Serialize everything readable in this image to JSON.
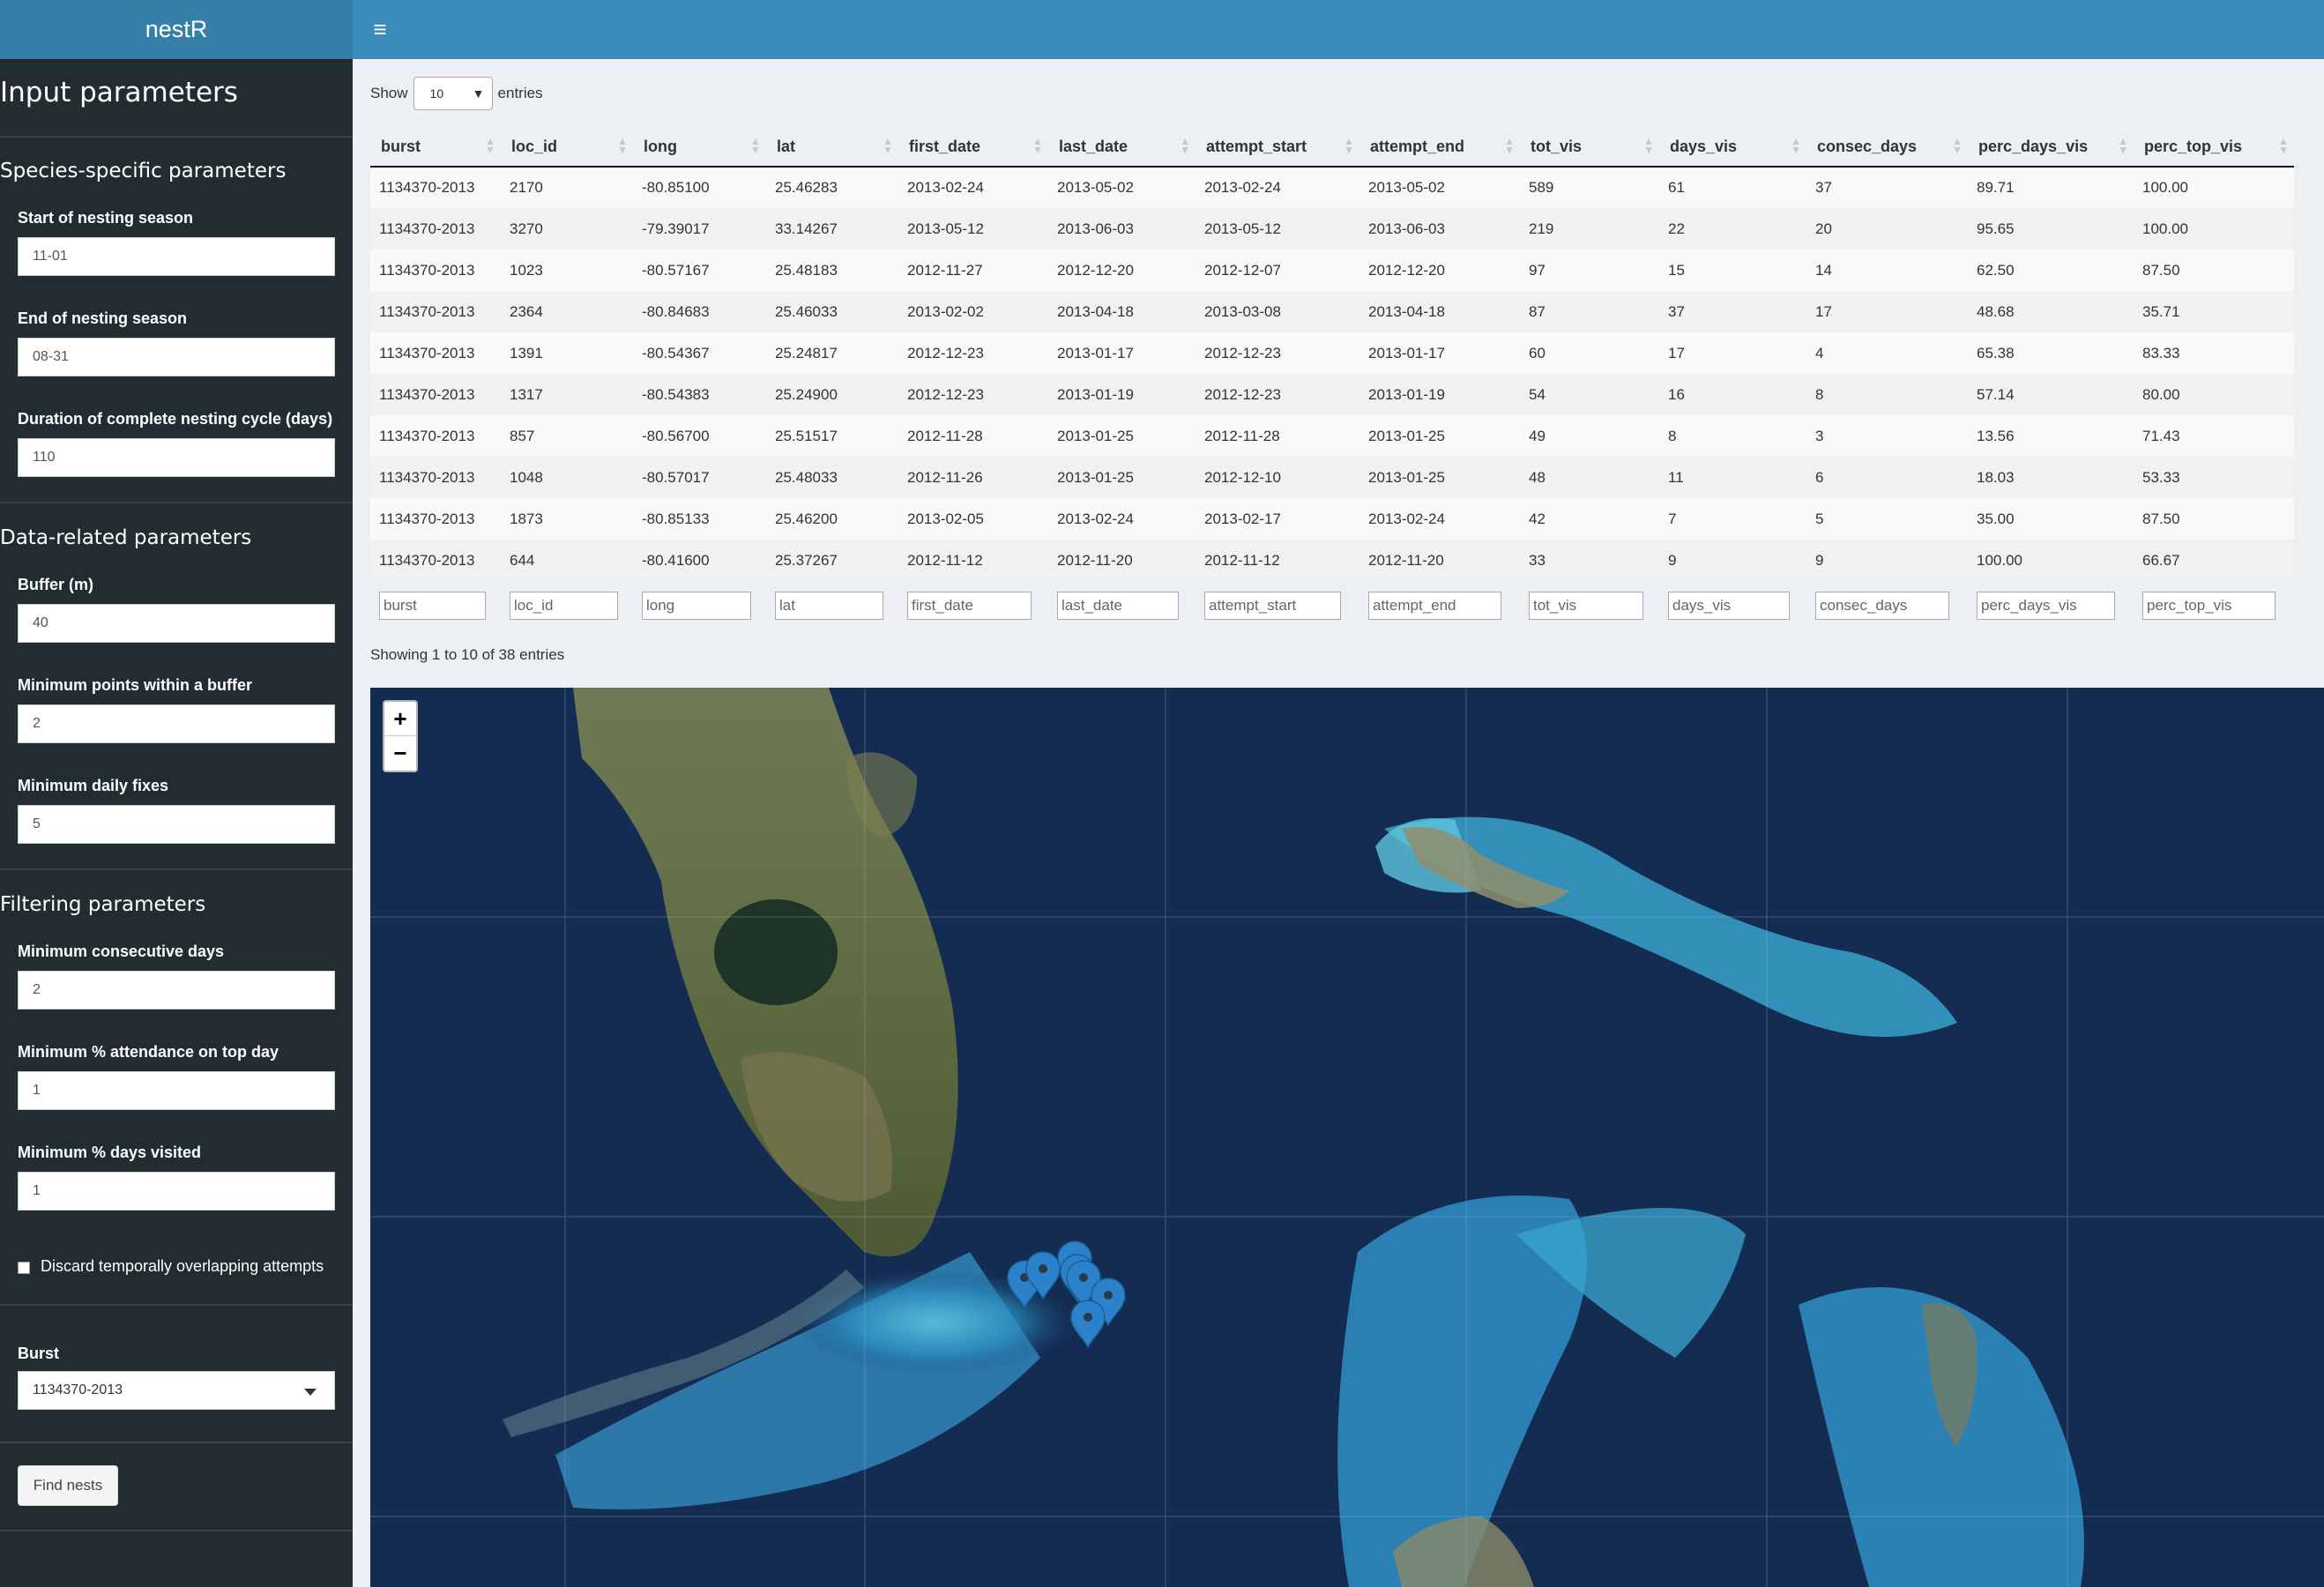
{
  "app": {
    "title": "nestR"
  },
  "sidebar": {
    "title": "Input parameters",
    "sections": {
      "species": "Species-specific parameters",
      "data": "Data-related parameters",
      "filtering": "Filtering parameters"
    },
    "fields": {
      "start_label": "Start of nesting season",
      "start_value": "11-01",
      "end_label": "End of nesting season",
      "end_value": "08-31",
      "cycle_label": "Duration of complete nesting cycle (days)",
      "cycle_value": "110",
      "buffer_label": "Buffer (m)",
      "buffer_value": "40",
      "minpts_label": "Minimum points within a buffer",
      "minpts_value": "2",
      "minfix_label": "Minimum daily fixes",
      "minfix_value": "5",
      "consec_label": "Minimum consecutive days",
      "consec_value": "2",
      "topday_label": "Minimum % attendance on top day",
      "topday_value": "1",
      "daysvis_label": "Minimum % days visited",
      "daysvis_value": "1",
      "discard_label": "Discard temporally overlapping attempts",
      "burst_label": "Burst",
      "burst_value": "1134370-2013",
      "find_button": "Find nests"
    }
  },
  "table": {
    "show_label": "Show",
    "entries_label": "entries",
    "page_length": "10",
    "columns": [
      "burst",
      "loc_id",
      "long",
      "lat",
      "first_date",
      "last_date",
      "attempt_start",
      "attempt_end",
      "tot_vis",
      "days_vis",
      "consec_days",
      "perc_days_vis",
      "perc_top_vis"
    ],
    "rows": [
      [
        "1134370-2013",
        "2170",
        "-80.85100",
        "25.46283",
        "2013-02-24",
        "2013-05-02",
        "2013-02-24",
        "2013-05-02",
        "589",
        "61",
        "37",
        "89.71",
        "100.00"
      ],
      [
        "1134370-2013",
        "3270",
        "-79.39017",
        "33.14267",
        "2013-05-12",
        "2013-06-03",
        "2013-05-12",
        "2013-06-03",
        "219",
        "22",
        "20",
        "95.65",
        "100.00"
      ],
      [
        "1134370-2013",
        "1023",
        "-80.57167",
        "25.48183",
        "2012-11-27",
        "2012-12-20",
        "2012-12-07",
        "2012-12-20",
        "97",
        "15",
        "14",
        "62.50",
        "87.50"
      ],
      [
        "1134370-2013",
        "2364",
        "-80.84683",
        "25.46033",
        "2013-02-02",
        "2013-04-18",
        "2013-03-08",
        "2013-04-18",
        "87",
        "37",
        "17",
        "48.68",
        "35.71"
      ],
      [
        "1134370-2013",
        "1391",
        "-80.54367",
        "25.24817",
        "2012-12-23",
        "2013-01-17",
        "2012-12-23",
        "2013-01-17",
        "60",
        "17",
        "4",
        "65.38",
        "83.33"
      ],
      [
        "1134370-2013",
        "1317",
        "-80.54383",
        "25.24900",
        "2012-12-23",
        "2013-01-19",
        "2012-12-23",
        "2013-01-19",
        "54",
        "16",
        "8",
        "57.14",
        "80.00"
      ],
      [
        "1134370-2013",
        "857",
        "-80.56700",
        "25.51517",
        "2012-11-28",
        "2013-01-25",
        "2012-11-28",
        "2013-01-25",
        "49",
        "8",
        "3",
        "13.56",
        "71.43"
      ],
      [
        "1134370-2013",
        "1048",
        "-80.57017",
        "25.48033",
        "2012-11-26",
        "2013-01-25",
        "2012-12-10",
        "2013-01-25",
        "48",
        "11",
        "6",
        "18.03",
        "53.33"
      ],
      [
        "1134370-2013",
        "1873",
        "-80.85133",
        "25.46200",
        "2013-02-05",
        "2013-02-24",
        "2013-02-17",
        "2013-02-24",
        "42",
        "7",
        "5",
        "35.00",
        "87.50"
      ],
      [
        "1134370-2013",
        "644",
        "-80.41600",
        "25.37267",
        "2012-11-12",
        "2012-11-20",
        "2012-11-12",
        "2012-11-20",
        "33",
        "9",
        "9",
        "100.00",
        "66.67"
      ]
    ],
    "info": "Showing 1 to 10 of 38 entries"
  },
  "map": {
    "zoom_in": "+",
    "zoom_out": "−",
    "marker_color": "#2b82cb"
  }
}
